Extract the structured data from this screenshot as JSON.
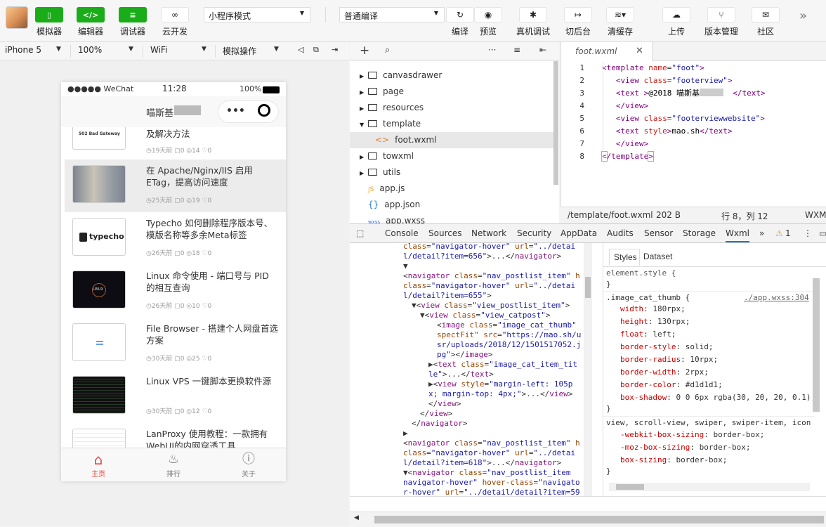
{
  "toolbar": {
    "buttons": [
      {
        "label": "模拟器",
        "icon": "phone-icon"
      },
      {
        "label": "编辑器",
        "icon": "code-icon"
      },
      {
        "label": "调试器",
        "icon": "debug-icon"
      },
      {
        "label": "云开发",
        "icon": "cloud-link-icon"
      }
    ],
    "mode_select": "小程序模式",
    "compile_select": "普通编译",
    "actions": [
      "编译",
      "预览",
      "真机调试",
      "切后台",
      "清缓存",
      "上传",
      "版本管理",
      "社区"
    ]
  },
  "device_bar": {
    "device": "iPhone 5",
    "zoom": "100%",
    "network": "WiFi",
    "operation": "模拟操作"
  },
  "phone": {
    "status": {
      "signal": "●●●●● WeChat",
      "time": "11:28",
      "battery": "100%"
    },
    "nav_title": "喵斯基",
    "posts": [
      {
        "title": "及解决方法",
        "meta_time": "19天前",
        "comments": "0",
        "views": "14",
        "likes": "0",
        "thumb_text": "502 Bad Gateway"
      },
      {
        "title": "在 Apache/Nginx/IIS 启用ETag，提高访问速度",
        "meta_time": "25天前",
        "comments": "0",
        "views": "19",
        "likes": "0"
      },
      {
        "title": "Typecho 如何删除程序版本号、模版名称等多余Meta标签",
        "meta_time": "26天前",
        "comments": "0",
        "views": "18",
        "likes": "0",
        "thumb_text": "typecho"
      },
      {
        "title": "Linux 命令使用 - 端口号与 PID 的相互查询",
        "meta_time": "26天前",
        "comments": "0",
        "views": "10",
        "likes": "0",
        "thumb_text": "LINUX"
      },
      {
        "title": "File Browser - 搭建个人网盘首选方案",
        "meta_time": "30天前",
        "comments": "0",
        "views": "25",
        "likes": "0"
      },
      {
        "title": "Linux VPS 一键脚本更换软件源",
        "meta_time": "30天前",
        "comments": "0",
        "views": "12",
        "likes": "0"
      },
      {
        "title": "LanProxy 使用教程：一款拥有WebUI的内网穿透工具",
        "meta_time": "",
        "comments": "",
        "views": "",
        "likes": ""
      }
    ],
    "tabs": [
      "主页",
      "排行",
      "关于"
    ]
  },
  "file_tree": {
    "items": [
      {
        "name": "canvasdrawer",
        "type": "folder",
        "open": false
      },
      {
        "name": "page",
        "type": "folder",
        "open": false
      },
      {
        "name": "resources",
        "type": "folder",
        "open": false
      },
      {
        "name": "template",
        "type": "folder",
        "open": true
      },
      {
        "name": "foot.wxml",
        "type": "wxml",
        "open": false
      },
      {
        "name": "towxml",
        "type": "folder",
        "open": false
      },
      {
        "name": "utils",
        "type": "folder",
        "open": false
      },
      {
        "name": "app.js",
        "type": "js",
        "open": false
      },
      {
        "name": "app.json",
        "type": "json",
        "open": false
      },
      {
        "name": "app.wxss",
        "type": "wxss",
        "open": false
      }
    ]
  },
  "editor": {
    "tab": "foot.wxml",
    "status_path": "/template/foot.wxml",
    "status_size": "202 B",
    "status_pos": "行 8，列 12",
    "status_lang": "WXM",
    "lines": [
      "1",
      "2",
      "3",
      "4",
      "5",
      "6",
      "7",
      "8"
    ]
  },
  "devtools": {
    "tabs": [
      "Console",
      "Sources",
      "Network",
      "Security",
      "AppData",
      "Audits",
      "Sensor",
      "Storage",
      "Wxml"
    ],
    "warning_count": "1",
    "styles_tabs": [
      "Styles",
      "Dataset"
    ],
    "style_source": "./app.wxss:304"
  }
}
